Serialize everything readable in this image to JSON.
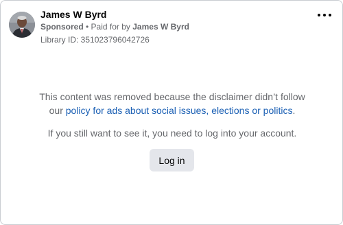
{
  "advertiser": {
    "name": "James W Byrd",
    "sponsored_label": "Sponsored",
    "separator": " • ",
    "paid_for_prefix": "Paid for by ",
    "paid_for_name": "James W Byrd",
    "library_id_text": "Library ID: 351023796042726",
    "avatar_icon": "profile-photo-icon"
  },
  "menu": {
    "more_icon": "more-options-icon"
  },
  "notice": {
    "line1": "This content was removed because the disclaimer didn’t follow",
    "line2_prefix": "our ",
    "policy_link": "policy for ads about social issues, elections or politics",
    "line2_suffix": ".",
    "login_prompt": "If you still want to see it, you need to log into your account."
  },
  "actions": {
    "login_label": "Log in"
  },
  "colors": {
    "link": "#1a5fb4",
    "secondary_text": "#65676b",
    "primary_text": "#050505",
    "button_bg": "#e4e6eb",
    "border": "#c9ccd1"
  }
}
